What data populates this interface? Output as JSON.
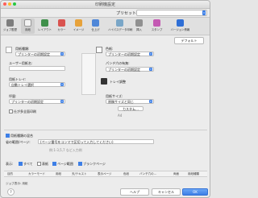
{
  "window": {
    "title": "印刷機設定"
  },
  "preset": {
    "label": "プリセット:",
    "value": ""
  },
  "toolbar": {
    "tabs": [
      {
        "label": "ジョブ履歴",
        "icon": "job-history-icon",
        "color": "#7d7d7d"
      },
      {
        "label": "用紙",
        "icon": "paper-icon",
        "color": "#f3f3f3"
      },
      {
        "label": "レイアウト",
        "icon": "layout-icon",
        "color": "#3f8f4a"
      },
      {
        "label": "カラー",
        "icon": "color-icon",
        "color": "#d9534f"
      },
      {
        "label": "イメージ",
        "icon": "image-icon",
        "color": "#e7a23a"
      },
      {
        "label": "仕上げ",
        "icon": "finishing-icon",
        "color": "#4f87d8"
      },
      {
        "label": "ハイパスデータ印刷",
        "icon": "highpass-icon",
        "color": "#7aa6c7"
      },
      {
        "label": "挿入",
        "icon": "insert-icon",
        "color": "#909090"
      },
      {
        "label": "スタンプ",
        "icon": "stamp-icon",
        "color": "#c45ab3"
      },
      {
        "label": "バージョン情報",
        "icon": "info-icon",
        "color": "#2f6fd6"
      }
    ]
  },
  "default_button": "デフォルト",
  "left": {
    "paper_type_label": "用紙種類:",
    "paper_type_value": "プリンターの初期設定",
    "user_paper_name_label": "ユーザー用紙名:",
    "user_paper_name_value": "",
    "paper_tray_label": "用紙トレイ:",
    "paper_tray_value": "自動トレイ選択",
    "paper_weight_label": "坪量:",
    "paper_weight_value": "プリンターの初期設定",
    "mixed_paper_label": "仕が多全面印刷"
  },
  "right": {
    "color_label": "色紙:",
    "color_value": "プリンターの初期設定",
    "tab_paper_label": "パンチ穴の有無:",
    "tab_paper_value": "プリンターの初期設定",
    "tray_adjust_label": "トレイ調整",
    "paper_size_label": "用紙サイズ:",
    "paper_size_value": "原稿サイズと同じ",
    "custom_button": "カスタム…",
    "size_value": "A4"
  },
  "custom_section": {
    "title": "用紙種類の混合",
    "pages_label": "省の範囲/ページ:",
    "pages_placeholder": "(ページ番号をコンマで区切って入力してください)",
    "hint": "例:1-3,5,7 など入力例"
  },
  "show": {
    "label": "表示:",
    "options": [
      {
        "label": "すべて",
        "checked": true
      },
      {
        "label": "表紙",
        "checked": false
      },
      {
        "label": "ページ範囲",
        "checked": true
      },
      {
        "label": "ブランクページ",
        "checked": true
      }
    ]
  },
  "table": {
    "columns": [
      "目的",
      "カラーモード",
      "用紙",
      "天/テキスト",
      "表示ページ",
      "色紙",
      "バンチ穴の...",
      "両面",
      "用紙種類"
    ]
  },
  "footer": {
    "link": "ジョブ表示: 用紙",
    "help": "?",
    "help_button": "ヘルプ",
    "cancel_button": "キャンセル",
    "ok_button": "OK"
  },
  "colors": {
    "accent": "#3d7fe6"
  }
}
